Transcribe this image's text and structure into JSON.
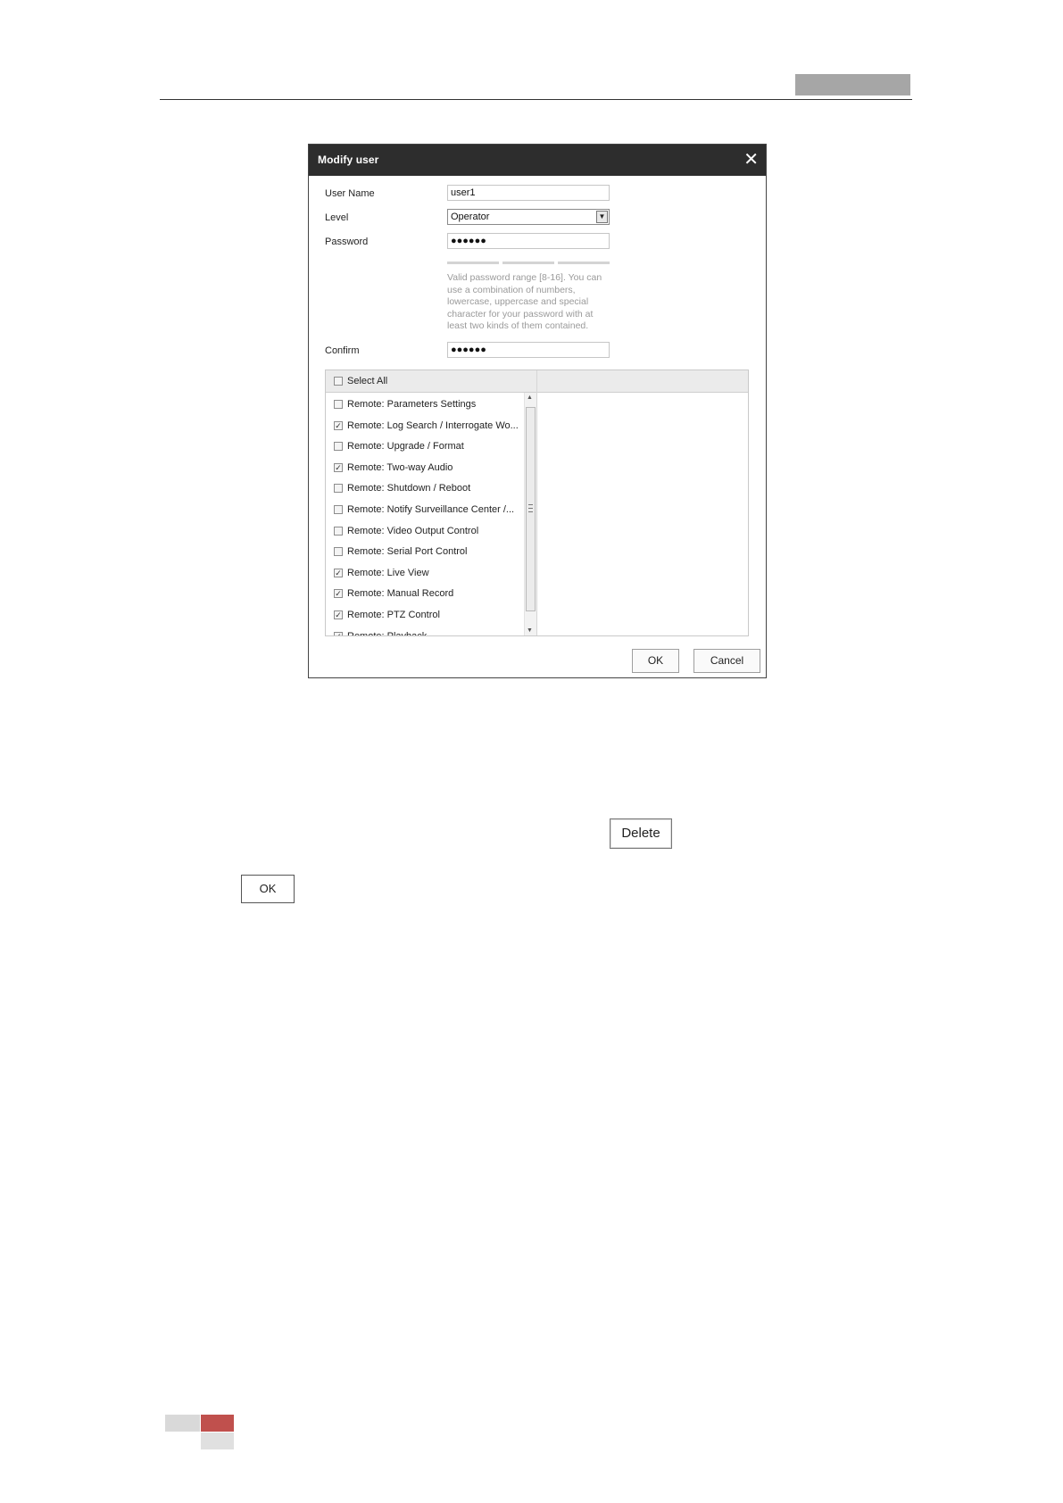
{
  "dialog": {
    "title": "Modify user",
    "close_glyph": "✕",
    "fields": {
      "username_label": "User Name",
      "username_value": "user1",
      "level_label": "Level",
      "level_value": "Operator",
      "password_label": "Password",
      "password_value": "●●●●●●",
      "password_hint": "Valid password range [8-16]. You can use a combination of numbers, lowercase, uppercase and special character for your password with at least two kinds of them contained.",
      "confirm_label": "Confirm",
      "confirm_value": "●●●●●●"
    },
    "permissions": {
      "select_all_label": "Select All",
      "select_all_checked": false,
      "items": [
        {
          "label": "Remote: Parameters Settings",
          "checked": false
        },
        {
          "label": "Remote: Log Search / Interrogate Wo...",
          "checked": true
        },
        {
          "label": "Remote: Upgrade / Format",
          "checked": false
        },
        {
          "label": "Remote: Two-way Audio",
          "checked": true
        },
        {
          "label": "Remote: Shutdown / Reboot",
          "checked": false
        },
        {
          "label": "Remote: Notify Surveillance Center /...",
          "checked": false
        },
        {
          "label": "Remote: Video Output Control",
          "checked": false
        },
        {
          "label": "Remote: Serial Port Control",
          "checked": false
        },
        {
          "label": "Remote: Live View",
          "checked": true
        },
        {
          "label": "Remote: Manual Record",
          "checked": true
        },
        {
          "label": "Remote: PTZ Control",
          "checked": true
        },
        {
          "label": "Remote: Playback",
          "checked": true
        }
      ]
    },
    "buttons": {
      "ok": "OK",
      "cancel": "Cancel"
    }
  },
  "page_buttons": {
    "delete": "Delete",
    "ok": "OK"
  },
  "colors": {
    "title_bar": "#2d2d2d",
    "header_accent": "#a6a6a6",
    "footer_red": "#c0504d",
    "footer_gray": "#d9d9d9"
  }
}
